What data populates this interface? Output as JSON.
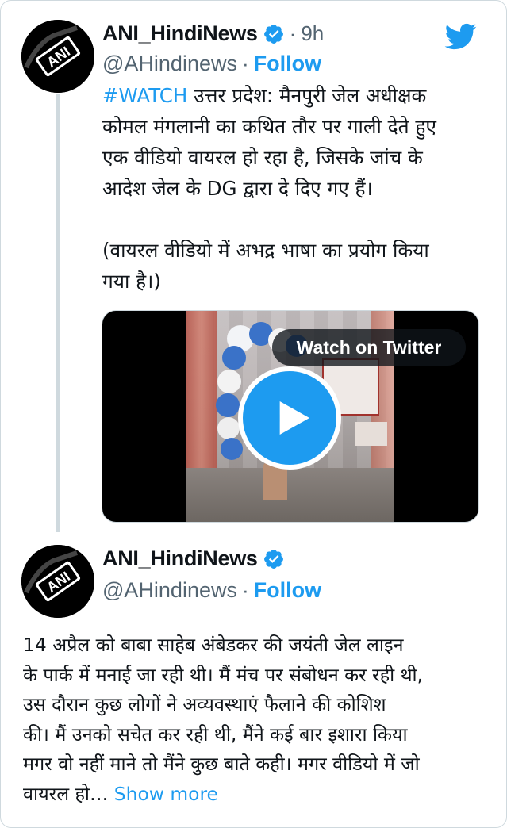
{
  "tweet1": {
    "display_name": "ANI_HindiNews",
    "time": "9h",
    "dot": "·",
    "handle": "@AHindinews",
    "follow_label": "Follow",
    "hashtag": "#WATCH",
    "line1_rest": " उत्तर प्रदेश: मैनपुरी जेल अधीक्षक",
    "line2": "कोमल मंगलानी का कथित तौर पर गाली देते हुए",
    "line3": "एक वीडियो वायरल हो रहा है, जिसके जांच के",
    "line4": "आदेश जेल के DG द्वारा दे दिए गए हैं।",
    "line5": "(वायरल वीडियो में अभद्र भाषा का प्रयोग किया",
    "line6": "गया है।)",
    "watch_label": "Watch on Twitter",
    "avatar_text": "ANI"
  },
  "tweet2": {
    "display_name": "ANI_HindiNews",
    "handle": "@AHindinews",
    "dot": "·",
    "follow_label": "Follow",
    "line1": "14 अप्रैल को बाबा साहेब अंबेडकर की जयंती जेल लाइन",
    "line2": "के पार्क में मनाई जा रही थी। मैं मंच पर संबोधन कर रही थी,",
    "line3": "उस दौरान कुछ लोगों ने अव्यवस्थाएं फैलाने की कोशिश",
    "line4": "की। मैं उनको सचेत कर रही थी, मैंने कई बार इशारा किया",
    "line5": "मगर वो नहीं माने तो मैंने कुछ बाते कही। मगर वीडियो में जो",
    "line6_start": "वायरल हो…",
    "show_more": " Show more",
    "avatar_text": "ANI"
  },
  "icons": {
    "twitter": "twitter-bird-icon",
    "verified": "verified-badge-icon",
    "play": "play-icon"
  },
  "colors": {
    "accent": "#1d9bf0",
    "text": "#0f1419",
    "muted": "#536471",
    "border": "#cfd9de"
  }
}
